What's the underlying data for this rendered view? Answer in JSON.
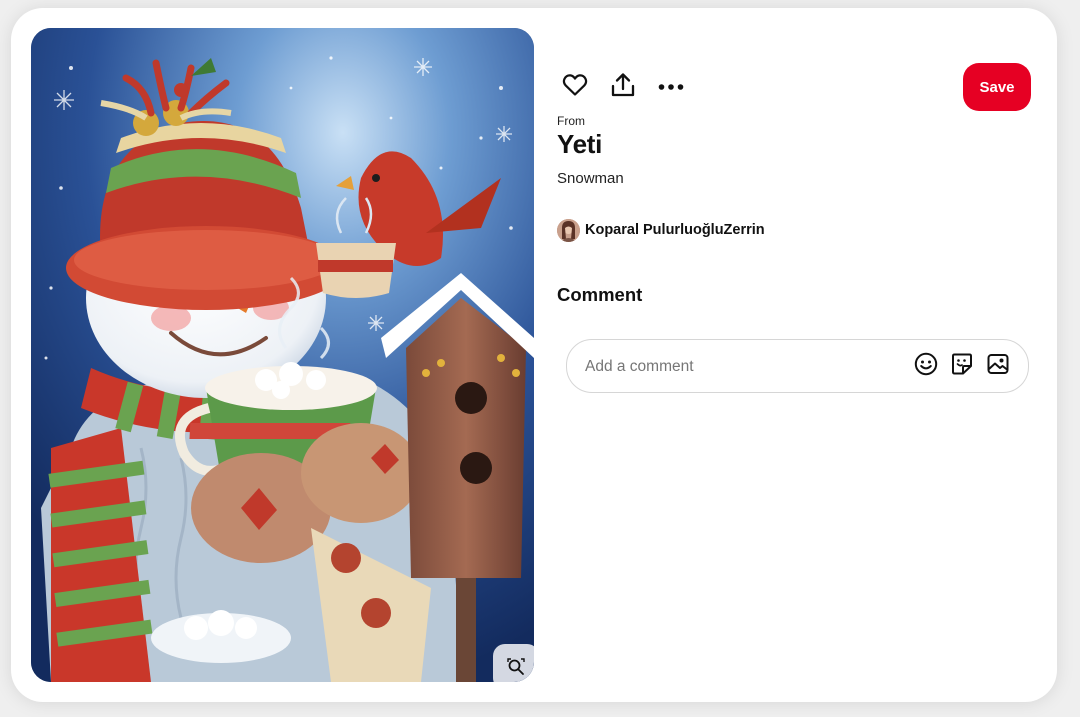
{
  "pin": {
    "image_alt": "Snowman",
    "from_label": "From",
    "title": "Yeti",
    "description": "Snowman"
  },
  "actions": {
    "like_icon": "heart-icon",
    "share_icon": "share-icon",
    "more_icon": "more-icon",
    "save_label": "Save"
  },
  "creator": {
    "name": "Koparal PulurluoğluZerrin"
  },
  "comments": {
    "heading": "Comment",
    "placeholder": "Add a comment",
    "value": "",
    "emoji_icon": "emoji-icon",
    "sticker_icon": "sticker-icon",
    "photo_icon": "photo-icon"
  },
  "colors": {
    "save_button": "#e60023",
    "page_background": "#efefef",
    "card_background": "#ffffff"
  }
}
